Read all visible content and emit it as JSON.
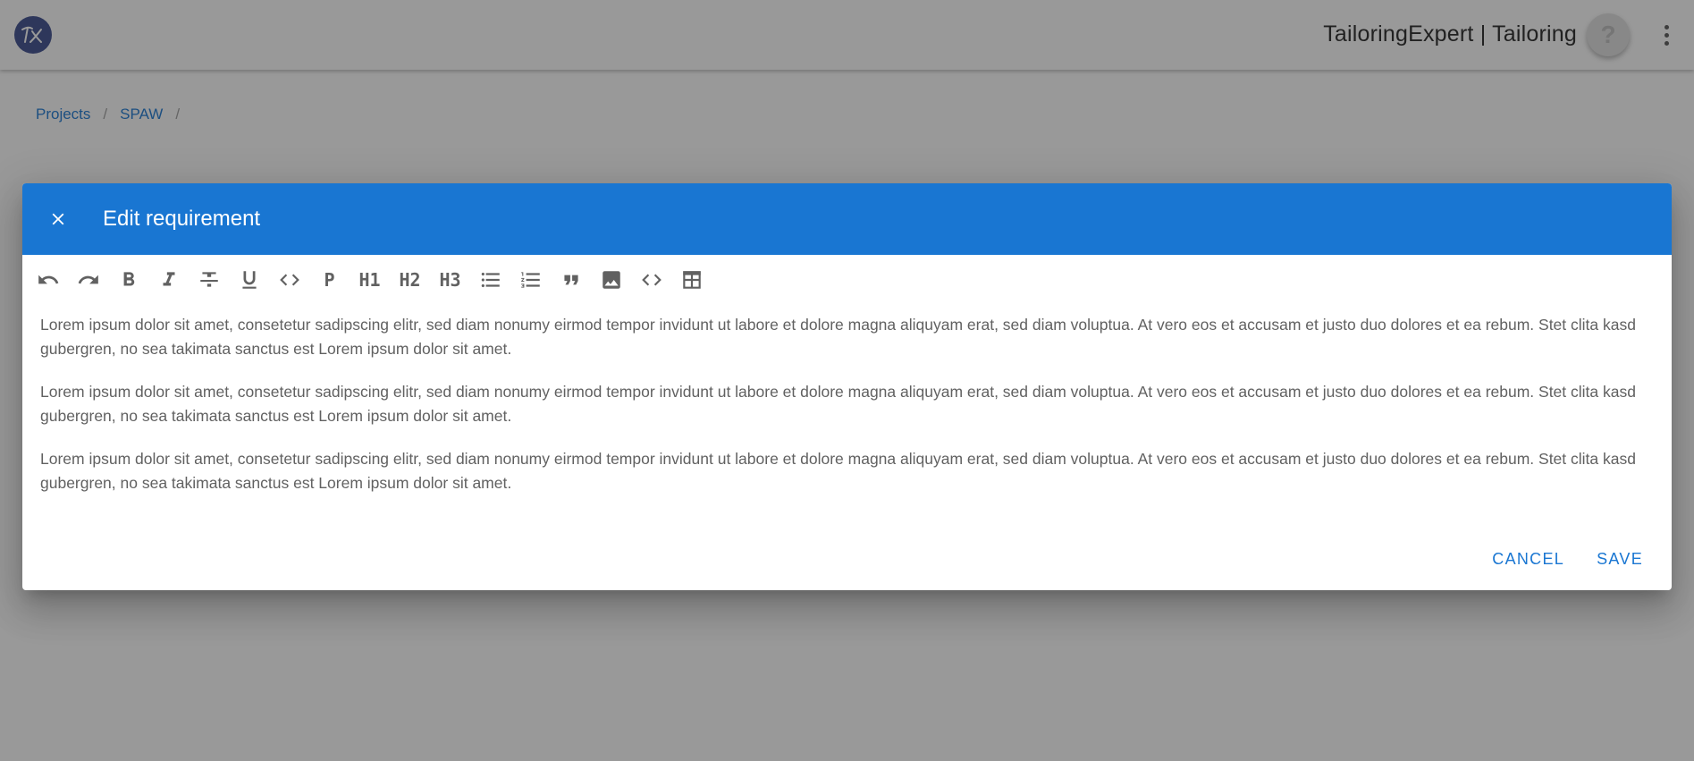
{
  "app": {
    "title": "TailoringExpert | Tailoring",
    "help_label": "?"
  },
  "breadcrumb": {
    "items": [
      "Projects",
      "SPAW"
    ],
    "separator": "/"
  },
  "dialog": {
    "title": "Edit requirement",
    "toolbar": {
      "paragraph": "P",
      "h1": "H1",
      "h2": "H2",
      "h3": "H3"
    },
    "paragraphs": [
      "Lorem ipsum dolor sit amet, consetetur sadipscing elitr, sed diam nonumy eirmod tempor invidunt ut labore et dolore magna aliquyam erat, sed diam voluptua. At vero eos et accusam et justo duo dolores et ea rebum. Stet clita kasd gubergren, no sea takimata sanctus est Lorem ipsum dolor sit amet.",
      "Lorem ipsum dolor sit amet, consetetur sadipscing elitr, sed diam nonumy eirmod tempor invidunt ut labore et dolore magna aliquyam erat, sed diam voluptua. At vero eos et accusam et justo duo dolores et ea rebum. Stet clita kasd gubergren, no sea takimata sanctus est Lorem ipsum dolor sit amet.",
      "Lorem ipsum dolor sit amet, consetetur sadipscing elitr, sed diam nonumy eirmod tempor invidunt ut labore et dolore magna aliquyam erat, sed diam voluptua. At vero eos et accusam et justo duo dolores et ea rebum. Stet clita kasd gubergren, no sea takimata sanctus est Lorem ipsum dolor sit amet."
    ],
    "cancel_label": "CANCEL",
    "save_label": "SAVE"
  },
  "colors": {
    "primary": "#1976d2",
    "logo": "#3a4a8c",
    "overlay": "rgba(33,33,33,0.46)",
    "text": "#616161"
  }
}
